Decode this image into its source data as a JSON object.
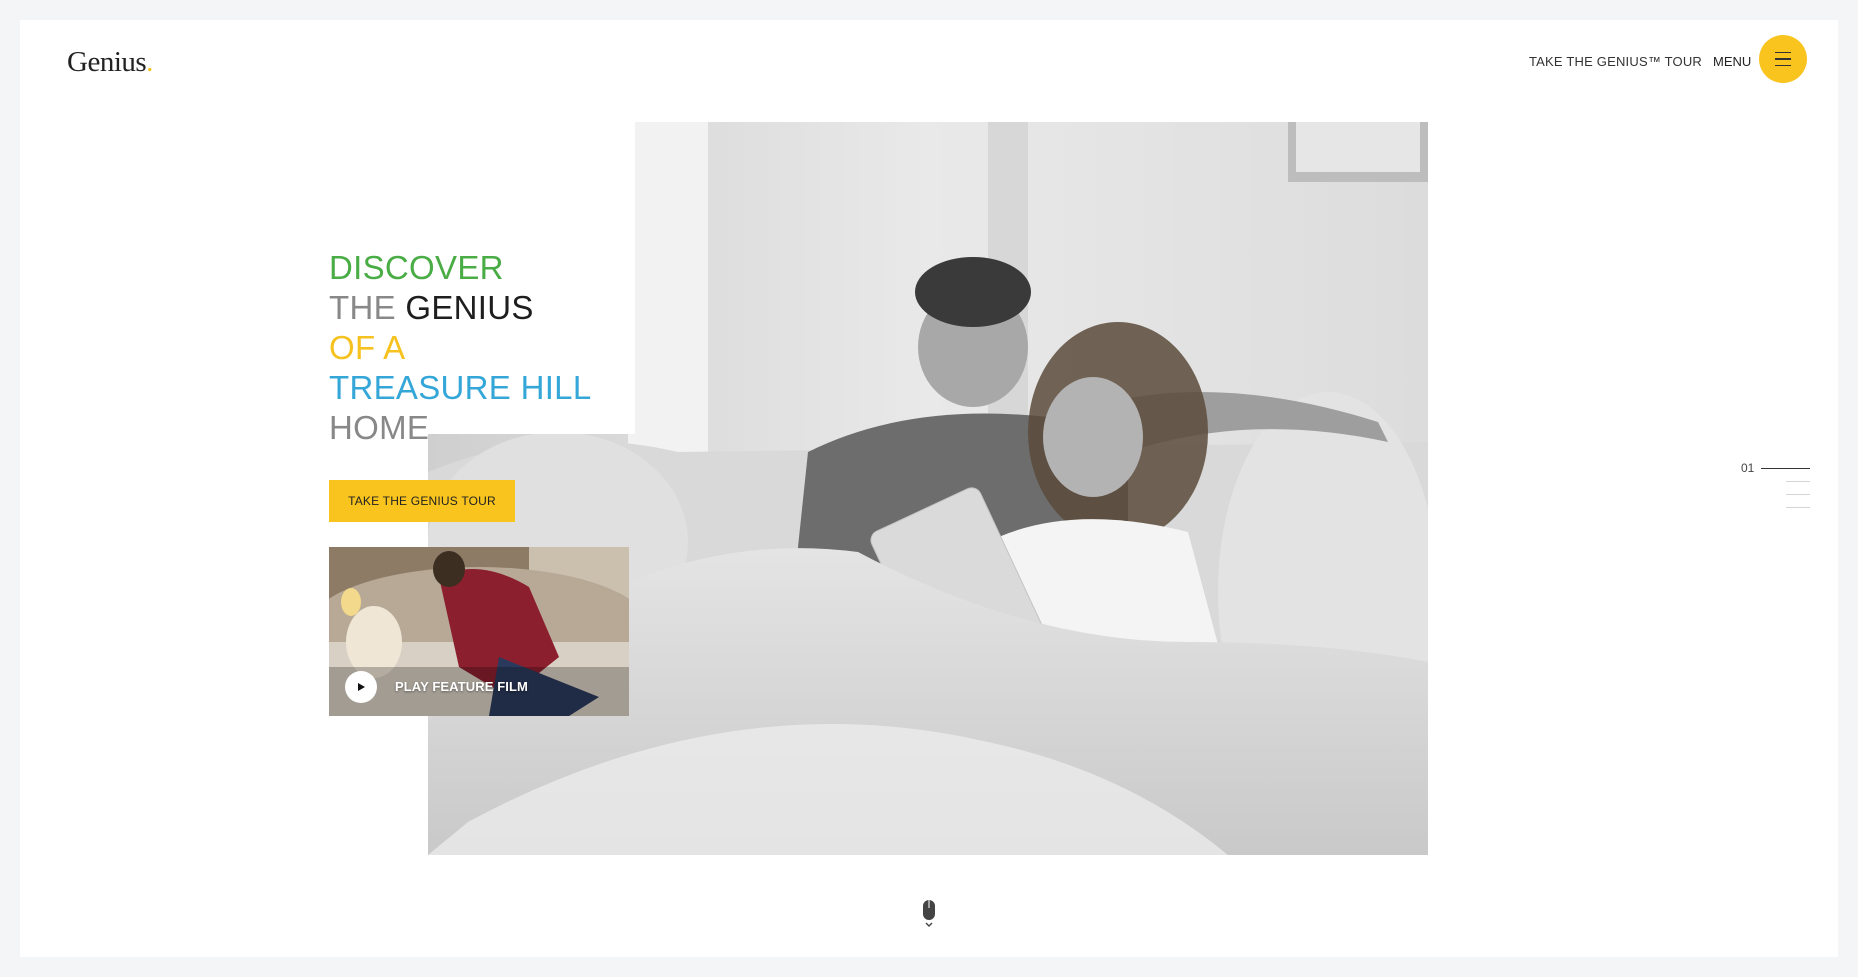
{
  "header": {
    "logo": "Genius",
    "logo_dot": ".",
    "tour_link": "TAKE THE GENIUS™ TOUR",
    "menu_label": "MENU"
  },
  "headline": {
    "line1": "DISCOVER",
    "line2a": "THE ",
    "line2b": "GENIUS",
    "line3": "OF A",
    "line4": "TREASURE HILL",
    "line5": "HOME"
  },
  "cta_label": "TAKE THE GENIUS TOUR",
  "video": {
    "label": "PLAY FEATURE FILM"
  },
  "slider": {
    "current": "01",
    "total_slides": 4
  },
  "colors": {
    "accent_yellow": "#f9c41e",
    "green": "#4aac45",
    "blue": "#34a6d8",
    "gray": "#888888"
  }
}
